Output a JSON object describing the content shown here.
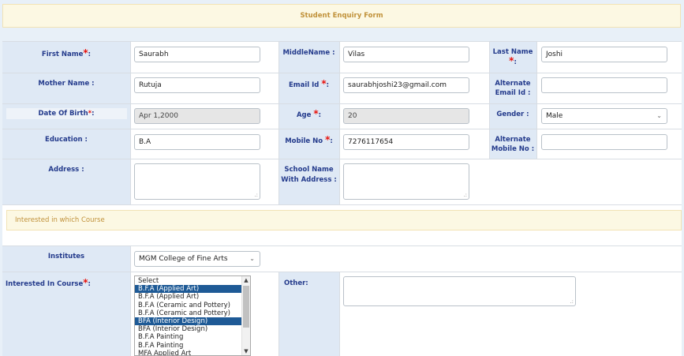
{
  "form": {
    "title": "Student Enquiry Form",
    "section_title": "Interested in which Course",
    "required_mark": "*"
  },
  "labels": {
    "first_name": "First Name",
    "middle_name": "MiddleName :",
    "last_name": "Last Name",
    "mother_name": "Mother Name :",
    "email_id": "Email Id",
    "alternate_email_1": "Alternate",
    "alternate_email_2": "Email Id :",
    "dob": "Date Of Birth",
    "age": "Age",
    "gender": "Gender :",
    "education": "Education :",
    "mobile_no": "Mobile No",
    "alternate_mobile_1": "Alternate",
    "alternate_mobile_2": "Mobile No :",
    "address": "Address :",
    "school_1": "School Name",
    "school_2": "With Address :",
    "institutes": "Institutes",
    "interested_course": "Interested In Course",
    "other": "Other:",
    "colon": ":"
  },
  "values": {
    "first_name": "Saurabh",
    "middle_name": "Vilas",
    "last_name": "Joshi",
    "mother_name": "Rutuja",
    "email_id": "saurabhjoshi23@gmail.com",
    "alternate_email": "",
    "dob": "Apr 1,2000",
    "age": "20",
    "gender": "Male",
    "education": "B.A",
    "mobile_no": "7276117654",
    "alternate_mobile": "",
    "institute": "MGM College of Fine Arts"
  },
  "course_options": [
    {
      "label": "Select",
      "selected": false
    },
    {
      "label": "B.F.A (Applied Art)",
      "selected": true
    },
    {
      "label": "B.F.A (Applied Art)",
      "selected": false
    },
    {
      "label": "B.F.A (Ceramic and Pottery)",
      "selected": false
    },
    {
      "label": "B.F.A (Ceramic and Pottery)",
      "selected": false
    },
    {
      "label": "BFA (Interior Design)",
      "selected": true
    },
    {
      "label": "BFA (Interior Design)",
      "selected": false
    },
    {
      "label": "B.F.A Painting",
      "selected": false
    },
    {
      "label": "B.F.A Painting",
      "selected": false
    },
    {
      "label": "MFA Applied Art",
      "selected": false
    }
  ],
  "icons": {
    "dropdown": "chevron-down-icon",
    "resize": "resize-grip-icon",
    "scroll_up": "scroll-up-icon",
    "scroll_down": "scroll-down-icon"
  },
  "colors": {
    "label_bg": "#dfe9f5",
    "label_text": "#243b8c",
    "header_bg": "#fcf8e3",
    "header_text": "#c0913a",
    "required": "#e8120c",
    "selected_option": "#1e5a96"
  }
}
